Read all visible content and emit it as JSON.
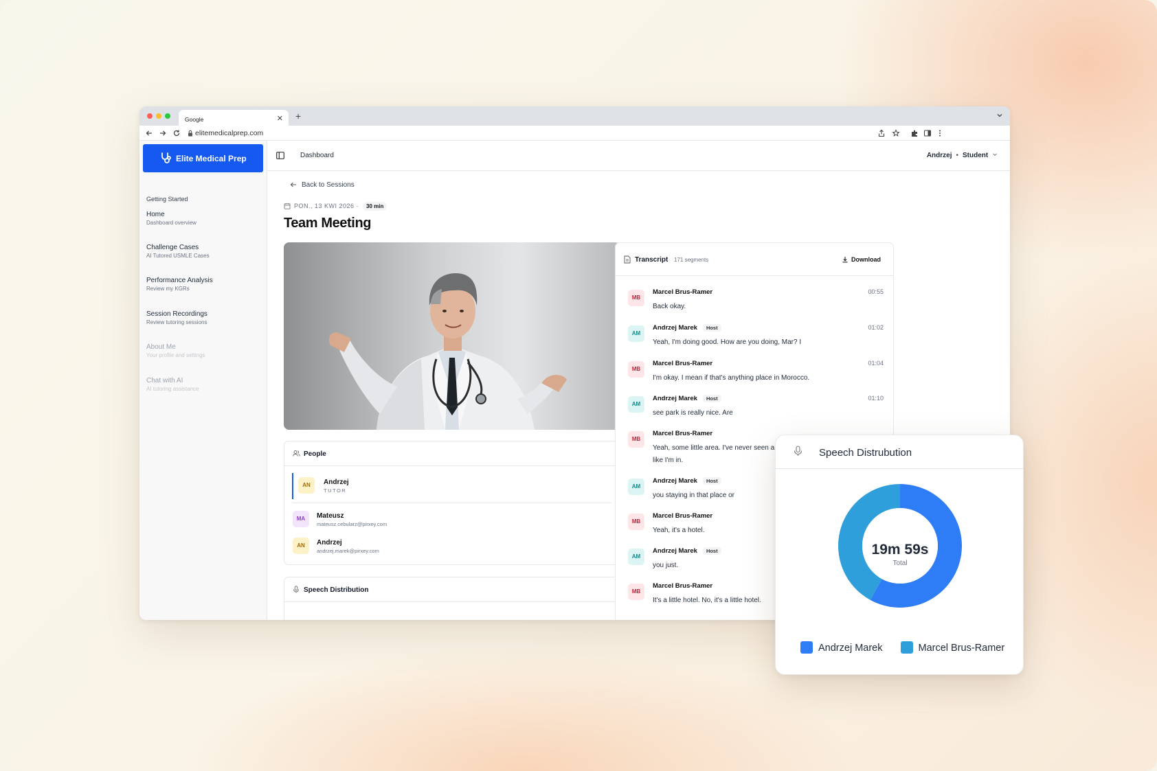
{
  "browser": {
    "tab_title": "Google",
    "url": "elitemedicalprep.com"
  },
  "brand": {
    "name": "Elite Medical Prep"
  },
  "sidebar": {
    "section": "Getting Started",
    "items": [
      {
        "title": "Home",
        "subtitle": "Dashboard overview"
      },
      {
        "title": "Challenge Cases",
        "subtitle": "AI Tutored USMLE Cases"
      },
      {
        "title": "Performance Analysis",
        "subtitle": "Review my KGRs"
      },
      {
        "title": "Session Recordings",
        "subtitle": "Review tutoring sessions"
      },
      {
        "title": "About Me",
        "subtitle": "Your profile and settings"
      },
      {
        "title": "Chat with AI",
        "subtitle": "AI tutoring assistance"
      }
    ]
  },
  "header": {
    "breadcrumb": "Dashboard",
    "user": "Andrzej",
    "role": "Student"
  },
  "session": {
    "back_label": "Back to Sessions",
    "date": "PON., 13 KWI 2026",
    "duration": "30 min",
    "title": "Team Meeting"
  },
  "people": {
    "title": "People",
    "members": [
      {
        "initials": "AN",
        "name": "Andrzej",
        "detail": "TUTOR"
      },
      {
        "initials": "MA",
        "name": "Mateusz",
        "detail": "mateusz.cebularz@pirxey.com"
      },
      {
        "initials": "AN",
        "name": "Andrzej",
        "detail": "andrzej.marek@pirxey.com"
      }
    ]
  },
  "speech_section": {
    "title": "Speech Distribution"
  },
  "transcript": {
    "title": "Transcript",
    "count": "171 segments",
    "download_label": "Download",
    "host_label": "Host",
    "segments": [
      {
        "initials": "MB",
        "speaker": "Marcel Brus-Ramer",
        "time": "00:55",
        "text": "Back okay."
      },
      {
        "initials": "AM",
        "speaker": "Andrzej Marek",
        "time": "01:02",
        "text": "Yeah, I'm doing good. How are you doing, Mar? I"
      },
      {
        "initials": "MB",
        "speaker": "Marcel Brus-Ramer",
        "time": "01:04",
        "text": "I'm okay. I mean if that's anything place in Morocco."
      },
      {
        "initials": "AM",
        "speaker": "Andrzej Marek",
        "time": "01:10",
        "text": "see park is really nice. Are"
      },
      {
        "initials": "MB",
        "speaker": "Marcel Brus-Ramer",
        "time": "",
        "text": "Yeah, some little area. I've never seen anything like this in my life. I feel like I'm in."
      },
      {
        "initials": "AM",
        "speaker": "Andrzej Marek",
        "time": "",
        "text": "you staying in that place or"
      },
      {
        "initials": "MB",
        "speaker": "Marcel Brus-Ramer",
        "time": "",
        "text": "Yeah, it's a hotel."
      },
      {
        "initials": "AM",
        "speaker": "Andrzej Marek",
        "time": "",
        "text": "you just."
      },
      {
        "initials": "MB",
        "speaker": "Marcel Brus-Ramer",
        "time": "",
        "text": "It's a little hotel. No, it's a little hotel."
      }
    ]
  },
  "speech_card": {
    "title": "Speech Distrubution",
    "total_value": "19m 59s",
    "total_label": "Total"
  },
  "chart_data": {
    "type": "pie",
    "title": "Speech Distrubution",
    "series": [
      {
        "name": "Andrzej Marek",
        "value": 0.58,
        "color": "#2f7df6"
      },
      {
        "name": "Marcel Brus-Ramer",
        "value": 0.42,
        "color": "#2f9fdc"
      }
    ],
    "center_label": "19m 59s",
    "center_sublabel": "Total",
    "legend_position": "bottom"
  },
  "colors": {
    "brand": "#1659f0",
    "andrzej": "#2f7df6",
    "marcel": "#2f9fdc"
  }
}
